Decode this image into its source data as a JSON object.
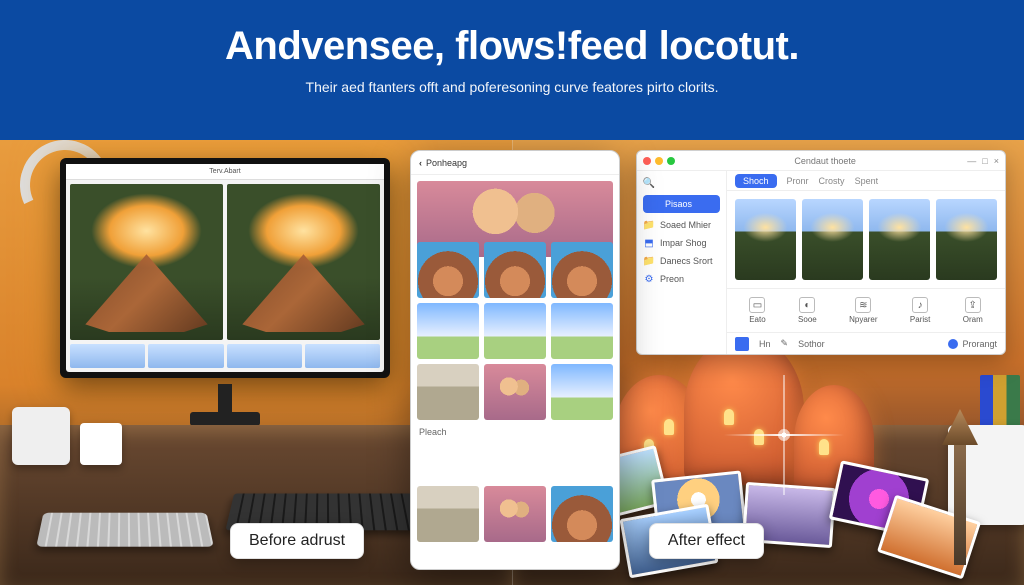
{
  "header": {
    "title": "Andvensee, flows!feed locotut.",
    "subtitle": "Their aed ftanters offt and poferesoning curve featores pirto clorits."
  },
  "labels": {
    "before": "Before adrust",
    "after": "After effect"
  },
  "monitor": {
    "titlebar": "Terv.Abart"
  },
  "tablet": {
    "back_glyph": "‹",
    "title": "Ponheapg",
    "section_label": "Pleach"
  },
  "appwin": {
    "title": "Cendaut thoete",
    "window_controls": {
      "min": "—",
      "max": "□",
      "close": "×"
    },
    "sidebar": {
      "primary": "Pisaos",
      "items": [
        "Soaed Mhier",
        "Impar Shog",
        "Danecs Srort",
        "Preon"
      ]
    },
    "tabs": [
      "Shoch",
      "Pronr",
      "Crosty",
      "Spent"
    ],
    "tools": [
      "Eato",
      "Sooe",
      "Npyarer",
      "Parist",
      "Oram"
    ],
    "footer": {
      "left1": "Hn",
      "left2": "Sothor",
      "right": "Prorangt"
    }
  },
  "icons": {
    "search": "🔍",
    "image": "▣",
    "folder": "📁",
    "tag": "⬒",
    "gear": "⚙",
    "crop": "▭",
    "adjust": "◐",
    "layers": "≋",
    "music": "♪",
    "share": "⇪"
  }
}
